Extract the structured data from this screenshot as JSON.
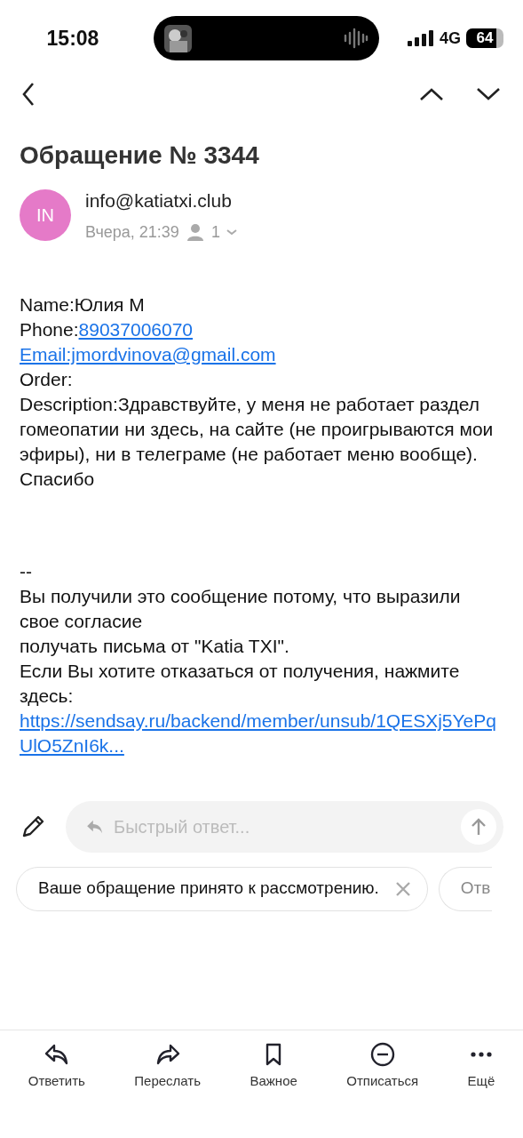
{
  "status_bar": {
    "time": "15:08",
    "network": "4G",
    "battery": "64"
  },
  "subject": "Обращение № 3344",
  "sender": {
    "initials": "IN",
    "email": "info@katiatxi.club",
    "date": "Вчера, 21:39",
    "recipients": "1"
  },
  "body": [
    {
      "kind": "text",
      "text": "Name:Юлия М"
    },
    {
      "kind": "labeled_link",
      "label": "Phone:",
      "link": "89037006070"
    },
    {
      "kind": "link",
      "text": "Email:jmordvinova@gmail.com"
    },
    {
      "kind": "text",
      "text": "Order:"
    },
    {
      "kind": "text",
      "text": "Description:Здравствуйте, у меня не работает раздел гомеопатии ни здесь, на сайте (не проигрываются мои эфиры), ни в телеграме (не работает меню вообще). Спасибо"
    },
    {
      "kind": "gap"
    },
    {
      "kind": "text",
      "text": "--"
    },
    {
      "kind": "text",
      "text": "Вы получили это сообщение потому, что выразили свое согласие"
    },
    {
      "kind": "text",
      "text": "получать письма от \"Katia TXI\"."
    },
    {
      "kind": "text",
      "text": "Если Вы хотите отказаться от получения, нажмите здесь:"
    },
    {
      "kind": "link",
      "text": "https://sendsay.ru/backend/member/unsub/1QESXj5YePqUlO5ZnI6k..."
    }
  ],
  "quick_reply": {
    "placeholder": "Быстрый ответ..."
  },
  "suggestions": [
    "Ваше обращение принято к рассмотрению.",
    "Отв"
  ],
  "toolbar": [
    {
      "kind": "reply",
      "label": "Ответить"
    },
    {
      "kind": "forward",
      "label": "Переслать"
    },
    {
      "kind": "bookmark",
      "label": "Важное"
    },
    {
      "kind": "unsubscribe",
      "label": "Отписаться"
    },
    {
      "kind": "more",
      "label": "Ещё"
    }
  ]
}
